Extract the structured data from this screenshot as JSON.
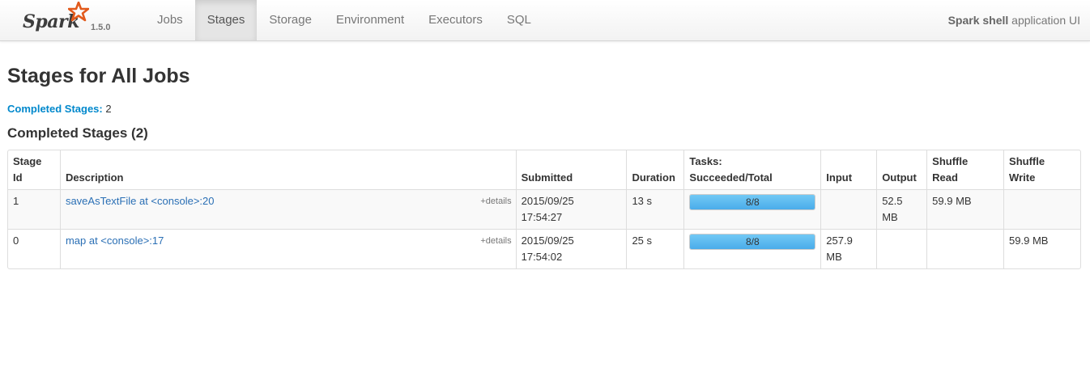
{
  "brand": {
    "name": "Spark",
    "version": "1.5.0",
    "accent_color": "#e25a1c"
  },
  "nav": {
    "tabs": [
      {
        "label": "Jobs"
      },
      {
        "label": "Stages",
        "active": true
      },
      {
        "label": "Storage"
      },
      {
        "label": "Environment"
      },
      {
        "label": "Executors"
      },
      {
        "label": "SQL"
      }
    ],
    "app_name": "Spark shell",
    "app_suffix": "application UI"
  },
  "page": {
    "title": "Stages for All Jobs",
    "summary_label": "Completed Stages:",
    "summary_count": "2",
    "section_title": "Completed Stages (2)"
  },
  "table": {
    "headers": {
      "stage_id_1": "Stage",
      "stage_id_2": "Id",
      "description": "Description",
      "submitted": "Submitted",
      "duration": "Duration",
      "tasks_1": "Tasks:",
      "tasks_2": "Succeeded/Total",
      "input": "Input",
      "output": "Output",
      "shuffle_read_1": "Shuffle",
      "shuffle_read_2": "Read",
      "shuffle_write_1": "Shuffle",
      "shuffle_write_2": "Write"
    },
    "details_label": "+details",
    "rows": [
      {
        "stage_id": "1",
        "description": "saveAsTextFile at <console>:20",
        "submitted_date": "2015/09/25",
        "submitted_time": "17:54:27",
        "duration": "13 s",
        "tasks_label": "8/8",
        "tasks_progress": 1.0,
        "input_1": "",
        "input_2": "",
        "output_1": "52.5",
        "output_2": "MB",
        "shuffle_read": "59.9 MB",
        "shuffle_write": ""
      },
      {
        "stage_id": "0",
        "description": "map at <console>:17",
        "submitted_date": "2015/09/25",
        "submitted_time": "17:54:02",
        "duration": "25 s",
        "tasks_label": "8/8",
        "tasks_progress": 1.0,
        "input_1": "257.9",
        "input_2": "MB",
        "output_1": "",
        "output_2": "",
        "shuffle_read": "",
        "shuffle_write": "59.9 MB"
      }
    ]
  }
}
